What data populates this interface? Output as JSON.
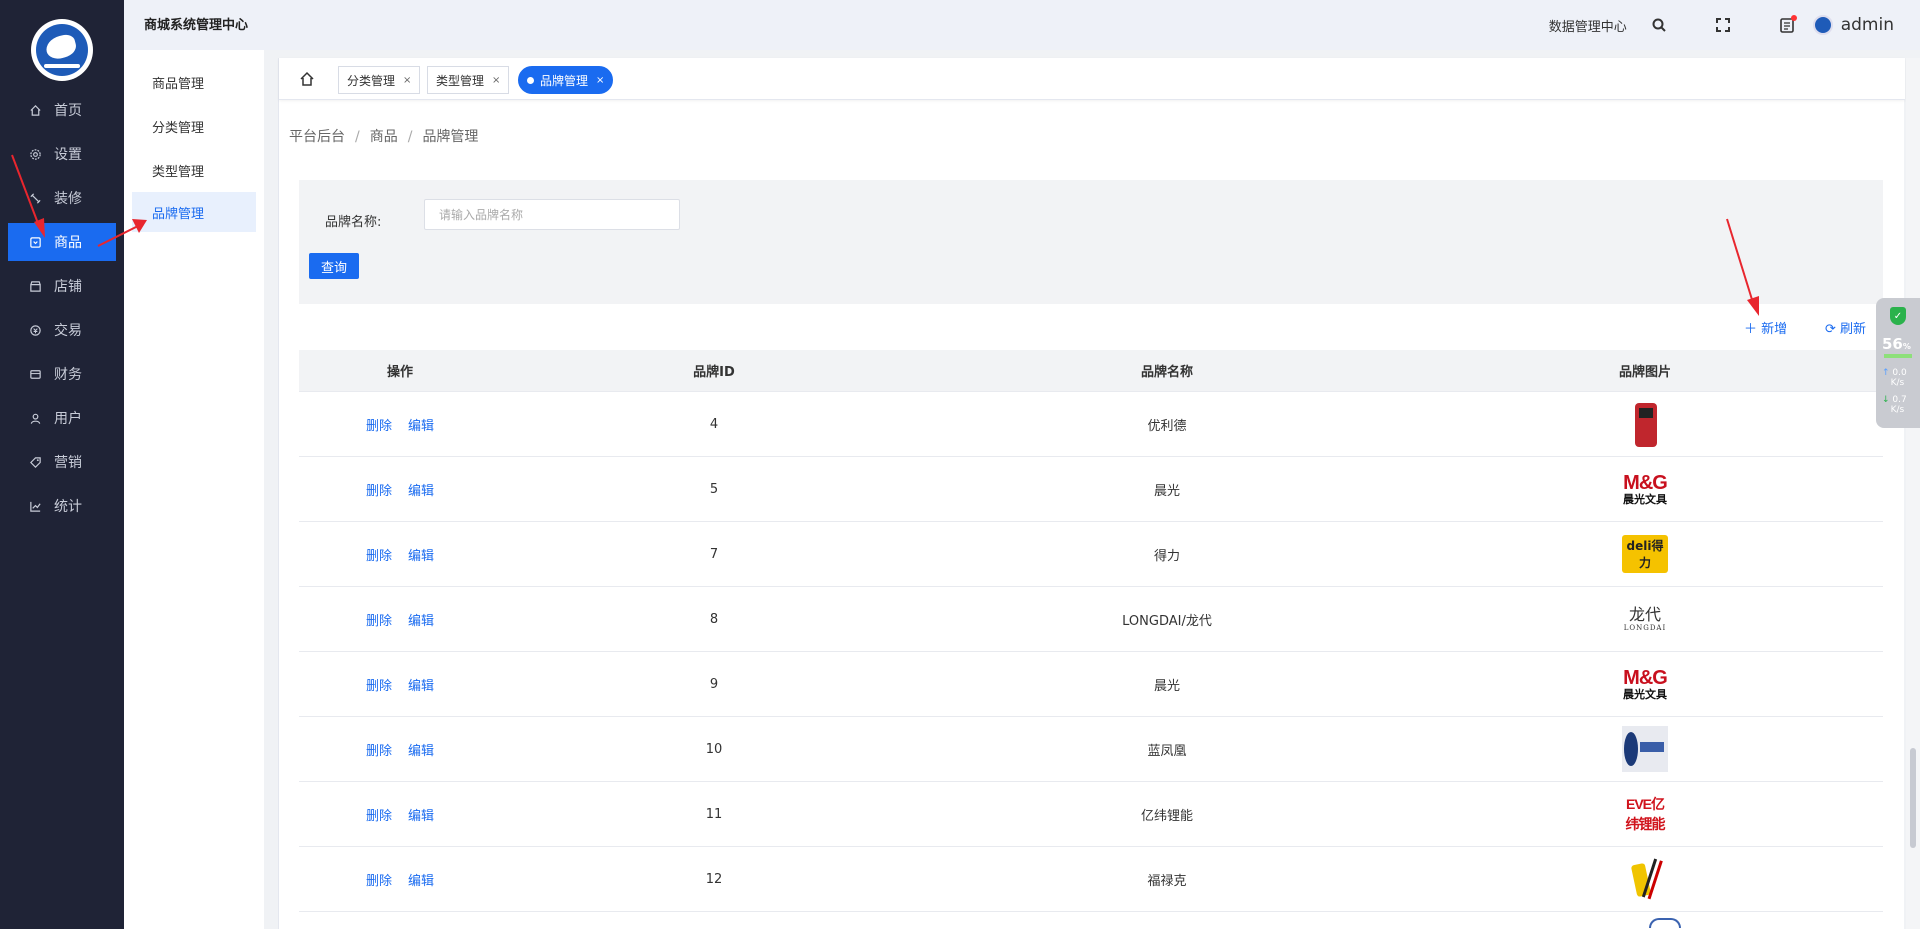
{
  "header": {
    "title": "商城系统管理中心",
    "data_center": "数据管理中心",
    "user": "admin"
  },
  "sidebar": {
    "items": [
      {
        "label": "首页",
        "icon": "home-icon"
      },
      {
        "label": "设置",
        "icon": "gear-icon"
      },
      {
        "label": "装修",
        "icon": "decorate-icon"
      },
      {
        "label": "商品",
        "icon": "product-icon",
        "active": true
      },
      {
        "label": "店铺",
        "icon": "shop-icon"
      },
      {
        "label": "交易",
        "icon": "trade-icon"
      },
      {
        "label": "财务",
        "icon": "finance-icon"
      },
      {
        "label": "用户",
        "icon": "user-icon"
      },
      {
        "label": "营销",
        "icon": "tag-icon"
      },
      {
        "label": "统计",
        "icon": "chart-icon"
      }
    ]
  },
  "submenu": {
    "items": [
      {
        "label": "商品管理"
      },
      {
        "label": "分类管理"
      },
      {
        "label": "类型管理"
      },
      {
        "label": "品牌管理",
        "active": true
      }
    ]
  },
  "tabs": [
    {
      "label": "分类管理"
    },
    {
      "label": "类型管理"
    },
    {
      "label": "品牌管理",
      "active": true
    }
  ],
  "breadcrumb": [
    "平台后台",
    "商品",
    "品牌管理"
  ],
  "search": {
    "label": "品牌名称:",
    "placeholder": "请输入品牌名称",
    "query_button": "查询"
  },
  "toolbar": {
    "add_label": "新增",
    "refresh_label": "刷新"
  },
  "table": {
    "headers": [
      "操作",
      "品牌ID",
      "品牌名称",
      "品牌图片"
    ],
    "action_delete": "删除",
    "action_edit": "编辑",
    "rows": [
      {
        "id": "4",
        "name": "优利德",
        "image": "multimeter"
      },
      {
        "id": "5",
        "name": "晨光",
        "image": "mg",
        "image_text": "M&G",
        "image_sub": "晨光文具"
      },
      {
        "id": "7",
        "name": "得力",
        "image": "deli",
        "image_text": "deli得力"
      },
      {
        "id": "8",
        "name": "LONGDAI/龙代",
        "image": "longdai",
        "image_text": "龙代",
        "image_sub": "LONGDAI"
      },
      {
        "id": "9",
        "name": "晨光",
        "image": "mg",
        "image_text": "M&G",
        "image_sub": "晨光文具"
      },
      {
        "id": "10",
        "name": "蓝凤凰",
        "image": "phoenix"
      },
      {
        "id": "11",
        "name": "亿纬锂能",
        "image": "eve",
        "image_text": "EVE亿纬锂能"
      },
      {
        "id": "12",
        "name": "福禄克",
        "image": "fluke"
      }
    ]
  },
  "net_widget": {
    "percent": "56",
    "percent_unit": "%",
    "up": "0.0",
    "down": "0.7",
    "unit": "K/s"
  },
  "colors": {
    "accent": "#1a6bf0",
    "sidebar_bg": "#1f2336",
    "annotation": "#e8262e"
  }
}
